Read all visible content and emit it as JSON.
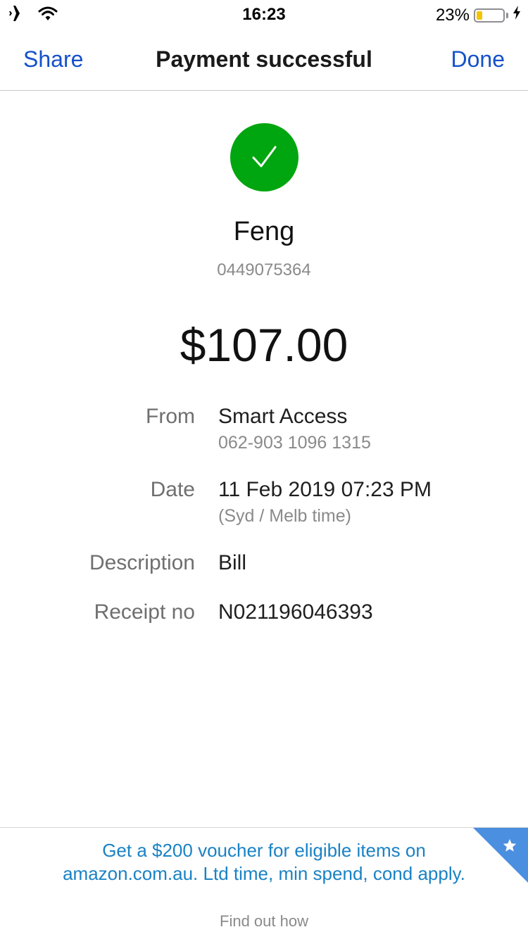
{
  "status_bar": {
    "time": "16:23",
    "battery_percent": "23%",
    "battery_level": 0.23,
    "icons": [
      "airplane-icon",
      "wifi-icon",
      "battery-icon",
      "charging-bolt-icon"
    ]
  },
  "nav": {
    "share_label": "Share",
    "title": "Payment successful",
    "done_label": "Done"
  },
  "status_icon": "checkmark-icon",
  "payee": {
    "name": "Feng",
    "number": "0449075364"
  },
  "amount": "$107.00",
  "details": {
    "from_label": "From",
    "from_value": "Smart Access",
    "from_sub": "062-903 1096 1315",
    "date_label": "Date",
    "date_value": "11 Feb 2019 07:23 PM",
    "date_sub": "(Syd / Melb time)",
    "description_label": "Description",
    "description_value": "Bill",
    "receipt_label": "Receipt no",
    "receipt_value": "N021196046393"
  },
  "promo": {
    "text": "Get a $200 voucher for eligible items on amazon.com.au. Ltd time, min spend, cond apply.",
    "link": "Find out how"
  },
  "colors": {
    "accent": "#1551c9",
    "success": "#00a60f",
    "promo_text": "#1a82c4",
    "promo_corner": "#4a8fe0"
  }
}
